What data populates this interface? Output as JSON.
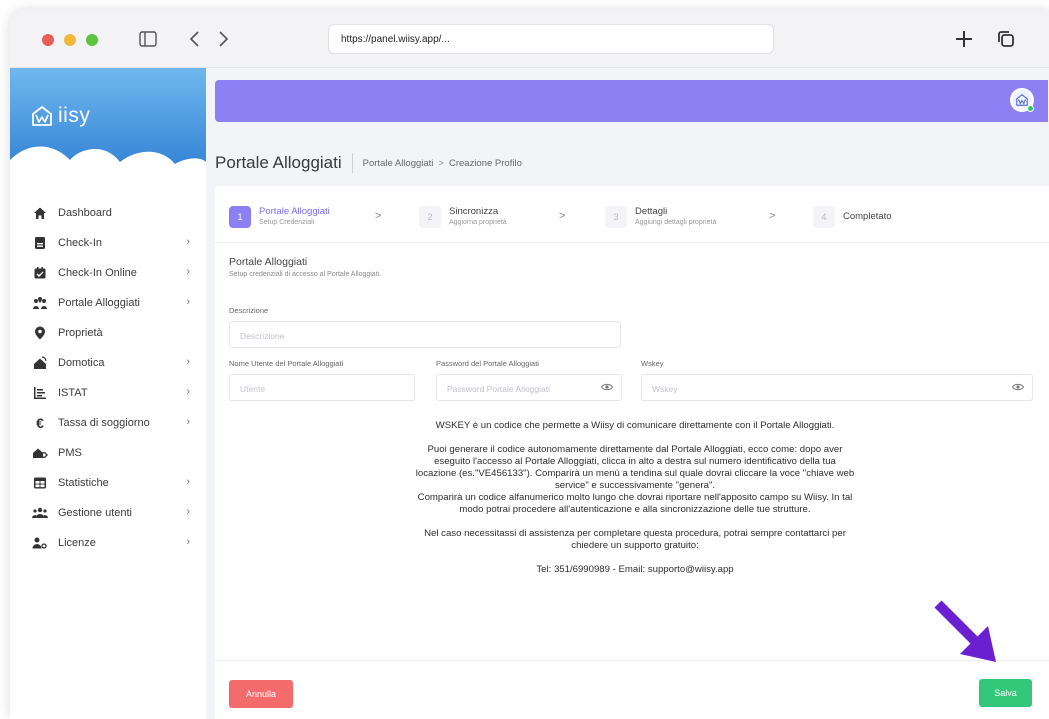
{
  "browser": {
    "url": "https://panel.wiisy.app/..."
  },
  "app": {
    "logo_text": "iisy"
  },
  "sidebar": {
    "items": [
      {
        "label": "Dashboard",
        "icon": "home-icon",
        "chevron": false
      },
      {
        "label": "Check-In",
        "icon": "clipboard-icon",
        "chevron": true
      },
      {
        "label": "Check-In Online",
        "icon": "calendar-check-icon",
        "chevron": true
      },
      {
        "label": "Portale Alloggiati",
        "icon": "users-location-icon",
        "chevron": true
      },
      {
        "label": "Proprietà",
        "icon": "map-pin-icon",
        "chevron": false
      },
      {
        "label": "Domotica",
        "icon": "smart-home-icon",
        "chevron": true
      },
      {
        "label": "ISTAT",
        "icon": "bar-list-icon",
        "chevron": true
      },
      {
        "label": "Tassa di soggiorno",
        "icon": "euro-icon",
        "chevron": true
      },
      {
        "label": "PMS",
        "icon": "house-key-icon",
        "chevron": false
      },
      {
        "label": "Statistiche",
        "icon": "table-icon",
        "chevron": true
      },
      {
        "label": "Gestione utenti",
        "icon": "users-icon",
        "chevron": true
      },
      {
        "label": "Licenze",
        "icon": "user-key-icon",
        "chevron": true
      }
    ]
  },
  "header": {
    "title": "Portale Alloggiati",
    "breadcrumb": [
      "Portale Alloggiati",
      "Creazione Profilo"
    ],
    "breadcrumb_sep": ">"
  },
  "stepper": {
    "steps": [
      {
        "num": "1",
        "title": "Portale Alloggiati",
        "sub": "Setup Credenziali",
        "active": true
      },
      {
        "num": "2",
        "title": "Sincronizza",
        "sub": "Aggiorna proprietà",
        "active": false
      },
      {
        "num": "3",
        "title": "Dettagli",
        "sub": "Aggiungi dettagli proprietà",
        "active": false
      },
      {
        "num": "4",
        "title": "Completato",
        "sub": "",
        "active": false
      }
    ],
    "arrow": ">"
  },
  "form": {
    "section_title": "Portale Alloggiati",
    "section_sub": "Setup credenziali di accesso al Portale Alloggiati.",
    "description_label": "Descrizione",
    "description_placeholder": "Descrizione",
    "username_label": "Nome Utente del Portale Alloggiati",
    "username_placeholder": "Utente",
    "password_label": "Password del Portale Alloggiati",
    "password_placeholder": "Password Portale Alloggiati",
    "wskey_label": "Wskey",
    "wskey_placeholder": "Wskey"
  },
  "info": {
    "p1": "WSKEY è un codice che permette a Wiisy di comunicare direttamente con il Portale Alloggiati.",
    "p2": "Puoi generare il codice autonomamente direttamente dal Portale Alloggiati, ecco come: dopo aver eseguito l'accesso al Portale Alloggiati, clicca in alto a destra sul numero identificativo della tua locazione (es.\"VE456133\"). Comparirà un menù a tendina sul quale dovrai cliccare la voce \"chiave web service\" e successivamente \"genera\".",
    "p3": "Comparirà un codice alfanumerico molto lungo che dovrai riportare nell'apposito campo su Wiisy. In tal modo potrai procedere all'autenticazione e alla sincronizzazione delle tue strutture.",
    "p4": "Nel caso necessitassi di assistenza per completare questa procedura, potrai sempre contattarci per chiedere un supporto gratuito:",
    "p5": "Tel: 351/6990989 - Email: supporto@wiisy.app"
  },
  "actions": {
    "cancel_label": "Annulla",
    "save_label": "Salva"
  },
  "colors": {
    "accent": "#8c80f4",
    "cancel": "#f36b6b",
    "save": "#33c77a",
    "pointer": "#6a1fd1"
  }
}
